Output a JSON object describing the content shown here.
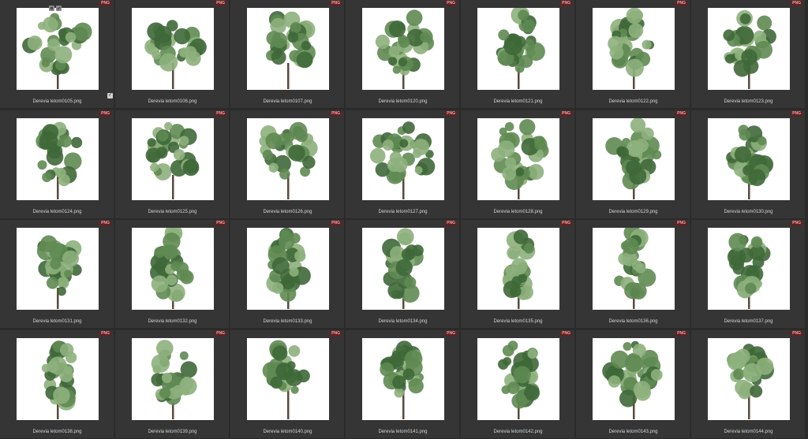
{
  "gallery": {
    "columns": 7,
    "badge_label": "PNG",
    "selected_index": 0,
    "items": [
      {
        "name": "Derevia letom0105.png",
        "shape": "wide"
      },
      {
        "name": "Derevia letom0106.png",
        "shape": "wide"
      },
      {
        "name": "Derevia letom0107.png",
        "shape": "wide"
      },
      {
        "name": "Derevia letom0120.png",
        "shape": "round"
      },
      {
        "name": "Derevia letom0121.png",
        "shape": "oval"
      },
      {
        "name": "Derevia letom0122.png",
        "shape": "oval"
      },
      {
        "name": "Derevia letom0123.png",
        "shape": "round"
      },
      {
        "name": "Derevia letom0124.png",
        "shape": "round"
      },
      {
        "name": "Derevia letom0125.png",
        "shape": "round"
      },
      {
        "name": "Derevia letom0126.png",
        "shape": "wide"
      },
      {
        "name": "Derevia letom0127.png",
        "shape": "wide"
      },
      {
        "name": "Derevia letom0128.png",
        "shape": "round"
      },
      {
        "name": "Derevia letom0129.png",
        "shape": "round"
      },
      {
        "name": "Derevia letom0130.png",
        "shape": "oval"
      },
      {
        "name": "Derevia letom0131.png",
        "shape": "oval"
      },
      {
        "name": "Derevia letom0132.png",
        "shape": "tall"
      },
      {
        "name": "Derevia letom0133.png",
        "shape": "tall"
      },
      {
        "name": "Derevia letom0134.png",
        "shape": "tall"
      },
      {
        "name": "Derevia letom0135.png",
        "shape": "narrow"
      },
      {
        "name": "Derevia letom0136.png",
        "shape": "tall"
      },
      {
        "name": "Derevia letom0137.png",
        "shape": "tall"
      },
      {
        "name": "Derevia letom0138.png",
        "shape": "tall"
      },
      {
        "name": "Derevia letom0139.png",
        "shape": "tall"
      },
      {
        "name": "Derevia letom0140.png",
        "shape": "sparse"
      },
      {
        "name": "Derevia letom0141.png",
        "shape": "sparse"
      },
      {
        "name": "Derevia letom0142.png",
        "shape": "oval"
      },
      {
        "name": "Derevia letom0143.png",
        "shape": "round"
      },
      {
        "name": "Derevia letom0144.png",
        "shape": "sparse"
      }
    ]
  },
  "colors": {
    "foliage": "#5f8a52",
    "foliage_dark": "#3f6838",
    "foliage_light": "#8db07c",
    "trunk": "#5a4a3c",
    "badge_bg": "#5a2525",
    "badge_text": "#ff9e9e"
  }
}
